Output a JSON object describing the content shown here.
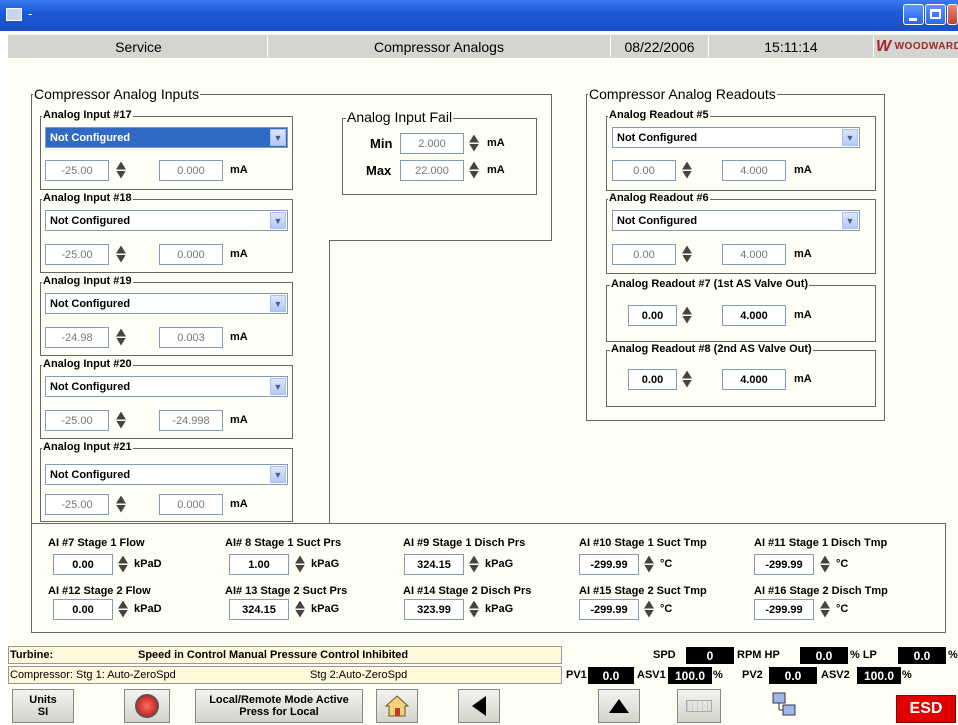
{
  "window": {
    "title_dash": "-"
  },
  "header": {
    "screen_name": "Service",
    "page_title": "Compressor Analogs",
    "date": "08/22/2006",
    "time": "15:11:14",
    "brand": "WOODWARD"
  },
  "inputs": {
    "title": "Compressor Analog Inputs",
    "items": [
      {
        "label": "Analog Input #17",
        "selection": "Not Configured",
        "value": "-25.00",
        "ma": "0.000",
        "unit": "mA"
      },
      {
        "label": "Analog Input #18",
        "selection": "Not Configured",
        "value": "-25.00",
        "ma": "0.000",
        "unit": "mA"
      },
      {
        "label": "Analog Input #19",
        "selection": "Not Configured",
        "value": "-24.98",
        "ma": "0.003",
        "unit": "mA"
      },
      {
        "label": "Analog Input #20",
        "selection": "Not Configured",
        "value": "-25.00",
        "ma": "-24.998",
        "unit": "mA"
      },
      {
        "label": "Analog Input #21",
        "selection": "Not Configured",
        "value": "-25.00",
        "ma": "0.000",
        "unit": "mA"
      }
    ]
  },
  "fail": {
    "title": "Analog Input Fail",
    "min_label": "Min",
    "min_value": "2.000",
    "max_label": "Max",
    "max_value": "22.000",
    "unit": "mA"
  },
  "readouts": {
    "title": "Compressor Analog Readouts",
    "items": [
      {
        "label": "Analog Readout #5",
        "selection": "Not Configured",
        "value": "0.00",
        "ma": "4.000",
        "unit": "mA"
      },
      {
        "label": "Analog Readout #6",
        "selection": "Not Configured",
        "value": "0.00",
        "ma": "4.000",
        "unit": "mA"
      },
      {
        "label": "Analog Readout #7 (1st AS Valve Out)",
        "value": "0.00",
        "ma": "4.000",
        "unit": "mA"
      },
      {
        "label": "Analog Readout #8 (2nd AS Valve Out)",
        "value": "0.00",
        "ma": "4.000",
        "unit": "mA"
      }
    ]
  },
  "ai_values": [
    {
      "label": "AI #7 Stage 1 Flow",
      "value": "0.00",
      "unit": "kPaD"
    },
    {
      "label": "AI# 8 Stage 1 Suct Prs",
      "value": "1.00",
      "unit": "kPaG"
    },
    {
      "label": "AI #9 Stage 1 Disch Prs",
      "value": "324.15",
      "unit": "kPaG"
    },
    {
      "label": "AI #10 Stage 1 Suct Tmp",
      "value": "-299.99",
      "unit": "°C"
    },
    {
      "label": "AI #11 Stage 1 Disch Tmp",
      "value": "-299.99",
      "unit": "°C"
    },
    {
      "label": "AI #12 Stage 2 Flow",
      "value": "0.00",
      "unit": "kPaD"
    },
    {
      "label": "AI# 13 Stage 2 Suct Prs",
      "value": "324.15",
      "unit": "kPaG"
    },
    {
      "label": "AI #14 Stage 2 Disch Prs",
      "value": "323.99",
      "unit": "kPaG"
    },
    {
      "label": "AI #15 Stage 2 Suct Tmp",
      "value": "-299.99",
      "unit": "°C"
    },
    {
      "label": "AI #16 Stage 2 Disch Tmp",
      "value": "-299.99",
      "unit": "°C"
    }
  ],
  "status": {
    "turbine_label": "Turbine:",
    "turbine_text": "Speed in Control Manual Pressure Control Inhibited",
    "compressor_text": "Compressor: Stg 1: Auto-ZeroSpd",
    "stg2_text": "Stg 2:Auto-ZeroSpd",
    "spd_label": "SPD",
    "spd_value": "0",
    "rpm_label": "RPM HP",
    "hp_value": "0.0",
    "pct_lp": "% LP",
    "lp_value": "0.0",
    "pct": "%",
    "pv1_label": "PV1",
    "pv1_value": "0.0",
    "asv1_label": "ASV1",
    "asv1_value": "100.0",
    "pct2": "%",
    "pv2_label": "PV2",
    "pv2_value": "0.0",
    "asv2_label": "ASV2",
    "asv2_value": "100.0",
    "pct3": "%"
  },
  "buttons": {
    "units_line1": "Units",
    "units_line2": "SI",
    "mode_line1": "Local/Remote Mode Active",
    "mode_line2": "Press for Local",
    "esd": "ESD"
  }
}
